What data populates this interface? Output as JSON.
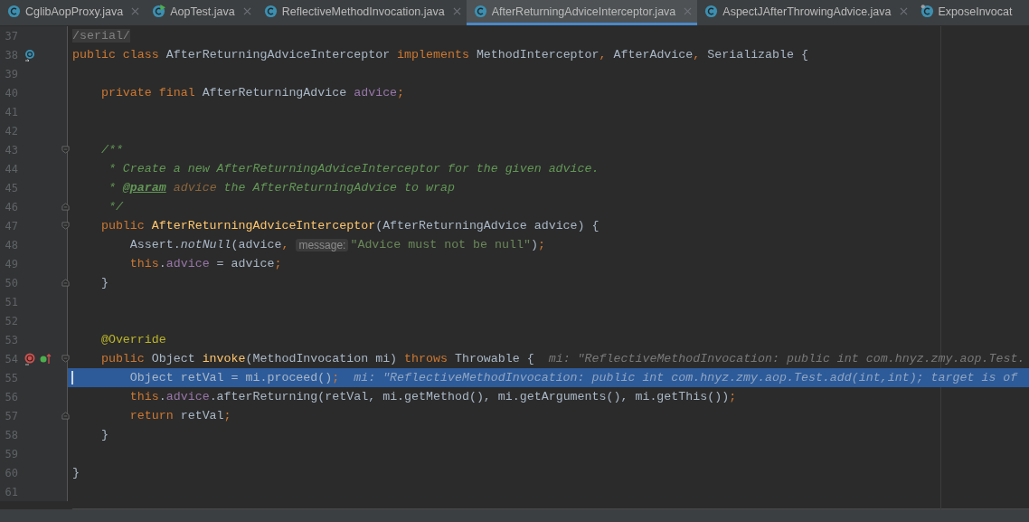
{
  "tabs": [
    {
      "label": "CglibAopProxy.java",
      "selected": false,
      "kind": "plain",
      "closable": true
    },
    {
      "label": "AopTest.java",
      "selected": false,
      "kind": "run",
      "closable": true
    },
    {
      "label": "ReflectiveMethodInvocation.java",
      "selected": false,
      "kind": "plain",
      "closable": true
    },
    {
      "label": "AfterReturningAdviceInterceptor.java",
      "selected": true,
      "kind": "plain",
      "closable": true
    },
    {
      "label": "AspectJAfterThrowingAdvice.java",
      "selected": false,
      "kind": "plain",
      "closable": true
    },
    {
      "label": "ExposeInvocat",
      "selected": false,
      "kind": "pinned",
      "closable": false
    }
  ],
  "editor": {
    "lines": [
      {
        "number": "37",
        "tokens": [
          {
            "t": "/serial/",
            "kind": "cut"
          }
        ]
      },
      {
        "number": "38",
        "gutter_icons": [
          {
            "kind": "implemented"
          }
        ],
        "tokens": [
          {
            "t": "public ",
            "kind": "kw"
          },
          {
            "t": "class ",
            "kind": "kw"
          },
          {
            "t": "AfterReturningAdviceInterceptor ",
            "kind": "plain"
          },
          {
            "t": "implements ",
            "kind": "kw"
          },
          {
            "t": "MethodInterceptor",
            "kind": "plain"
          },
          {
            "t": ", ",
            "kind": "punct"
          },
          {
            "t": "AfterAdvice",
            "kind": "plain"
          },
          {
            "t": ", ",
            "kind": "punct"
          },
          {
            "t": "Serializable {",
            "kind": "plain"
          }
        ]
      },
      {
        "number": "39"
      },
      {
        "number": "40",
        "tokens": [
          {
            "t": "    private final ",
            "kind": "kw"
          },
          {
            "t": "AfterReturningAdvice ",
            "kind": "plain"
          },
          {
            "t": "advice",
            "kind": "field"
          },
          {
            "t": ";",
            "kind": "punct"
          }
        ]
      },
      {
        "number": "41"
      },
      {
        "number": "42"
      },
      {
        "number": "43",
        "fold": {
          "kind": "start"
        },
        "tokens": [
          {
            "t": "    /**",
            "kind": "comment"
          }
        ]
      },
      {
        "number": "44",
        "tokens": [
          {
            "t": "     * Create a new AfterReturningAdviceInterceptor for the given advice.",
            "kind": "comment"
          }
        ]
      },
      {
        "number": "45",
        "tokens": [
          {
            "t": "     * ",
            "kind": "comment"
          },
          {
            "t": "@param",
            "kind": "tag"
          },
          {
            "t": " advice",
            "kind": "pref"
          },
          {
            "t": " the AfterReturningAdvice to wrap",
            "kind": "comment"
          }
        ]
      },
      {
        "number": "46",
        "fold": {
          "kind": "end"
        },
        "tokens": [
          {
            "t": "     */",
            "kind": "comment"
          }
        ]
      },
      {
        "number": "47",
        "fold": {
          "kind": "start"
        },
        "tokens": [
          {
            "t": "    public ",
            "kind": "kw"
          },
          {
            "t": "AfterReturningAdviceInterceptor",
            "kind": "fn"
          },
          {
            "t": "(AfterReturningAdvice advice) {",
            "kind": "plain"
          }
        ]
      },
      {
        "number": "48",
        "tokens": [
          {
            "t": "        Assert.",
            "kind": "plain"
          },
          {
            "t": "notNull",
            "kind": "static"
          },
          {
            "t": "(advice",
            "kind": "plain"
          },
          {
            "t": ", ",
            "kind": "punct"
          },
          {
            "t": "message:",
            "kind": "inlay"
          },
          {
            "t": "\"Advice must not be null\"",
            "kind": "str"
          },
          {
            "t": ")",
            "kind": "plain"
          },
          {
            "t": ";",
            "kind": "punct"
          }
        ]
      },
      {
        "number": "49",
        "tokens": [
          {
            "t": "        this",
            "kind": "kw"
          },
          {
            "t": ".",
            "kind": "plain"
          },
          {
            "t": "advice",
            "kind": "field"
          },
          {
            "t": " = advice",
            "kind": "plain"
          },
          {
            "t": ";",
            "kind": "punct"
          }
        ]
      },
      {
        "number": "50",
        "fold": {
          "kind": "end"
        },
        "tokens": [
          {
            "t": "    }",
            "kind": "plain"
          }
        ]
      },
      {
        "number": "51"
      },
      {
        "number": "52"
      },
      {
        "number": "53",
        "tokens": [
          {
            "t": "    @Override",
            "kind": "ann"
          }
        ]
      },
      {
        "number": "54",
        "gutter_icons": [
          {
            "kind": "method-breakpoint"
          },
          {
            "kind": "overrides"
          }
        ],
        "fold": {
          "kind": "start"
        },
        "tokens": [
          {
            "t": "    public ",
            "kind": "kw"
          },
          {
            "t": "Object ",
            "kind": "plain"
          },
          {
            "t": "invoke",
            "kind": "fn"
          },
          {
            "t": "(MethodInvocation mi) ",
            "kind": "plain"
          },
          {
            "t": "throws ",
            "kind": "kw"
          },
          {
            "t": "Throwable {",
            "kind": "plain"
          },
          {
            "t": "  mi: \"ReflectiveMethodInvocation: public int com.hnyz.zmy.aop.Test.",
            "kind": "hint"
          }
        ]
      },
      {
        "number": "55",
        "selected": true,
        "tokens": [
          {
            "t": "        Object retVal = mi.proceed()",
            "kind": "plain"
          },
          {
            "t": ";",
            "kind": "punct"
          },
          {
            "t": "  mi: \"ReflectiveMethodInvocation: public int com.hnyz.zmy.aop.Test.add(int,int); target is of",
            "kind": "hint"
          }
        ]
      },
      {
        "number": "56",
        "tokens": [
          {
            "t": "        this",
            "kind": "kw"
          },
          {
            "t": ".",
            "kind": "plain"
          },
          {
            "t": "advice",
            "kind": "field"
          },
          {
            "t": ".afterReturning(retVal, mi.getMethod(), mi.getArguments(), mi.getThis())",
            "kind": "plain"
          },
          {
            "t": ";",
            "kind": "punct"
          }
        ]
      },
      {
        "number": "57",
        "fold": {
          "kind": "end"
        },
        "tokens": [
          {
            "t": "        return ",
            "kind": "kw"
          },
          {
            "t": "retVal",
            "kind": "plain"
          },
          {
            "t": ";",
            "kind": "punct"
          }
        ]
      },
      {
        "number": "58",
        "tokens": [
          {
            "t": "    }",
            "kind": "plain"
          }
        ]
      },
      {
        "number": "59"
      },
      {
        "number": "60",
        "tokens": [
          {
            "t": "}",
            "kind": "plain"
          }
        ]
      },
      {
        "number": "61"
      }
    ]
  }
}
